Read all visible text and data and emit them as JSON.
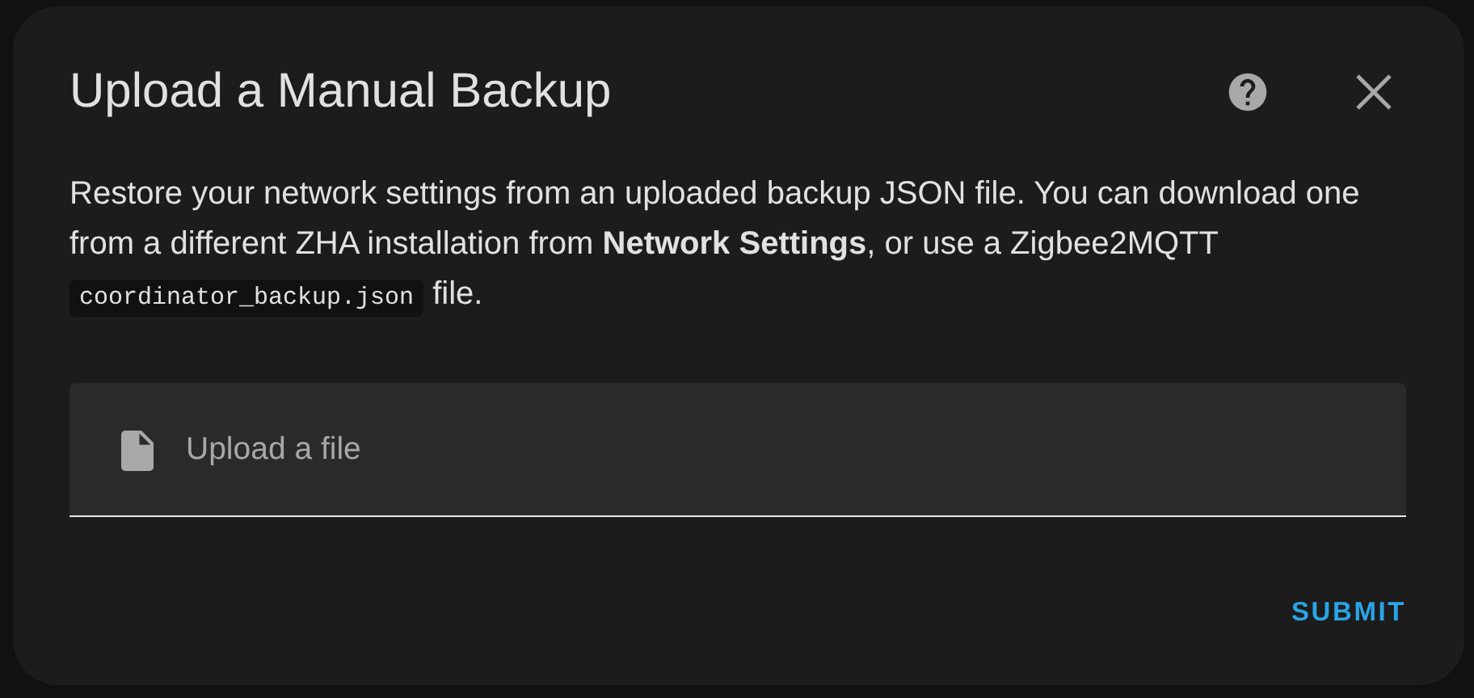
{
  "dialog": {
    "title": "Upload a Manual Backup",
    "description": [
      "Restore your network settings from an uploaded backup JSON file. You can download one from a different ZHA installation from **Network Settings**, or use a Zigbee2MQTT ",
      "coordinator_backup.json",
      " file."
    ],
    "upload_field": {
      "placeholder": "Upload a file"
    },
    "buttons": [
      "SUBMIT"
    ]
  }
}
